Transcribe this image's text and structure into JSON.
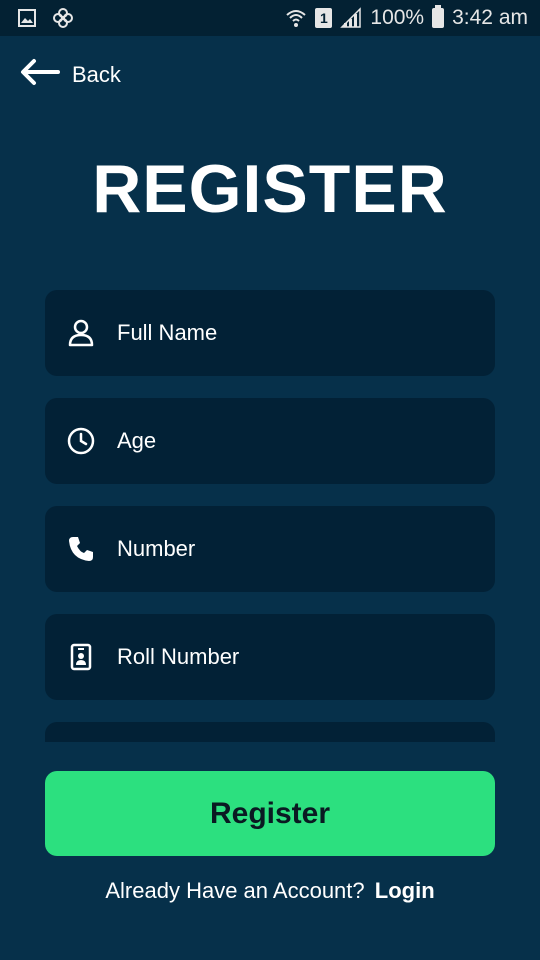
{
  "status_bar": {
    "battery_percent": "100%",
    "time": "3:42 am",
    "sim_slot": "1",
    "icons": [
      "gallery-icon",
      "pinwheel-icon",
      "wifi-icon",
      "sim-icon",
      "signal-icon",
      "battery-icon"
    ]
  },
  "header": {
    "back_label": "Back",
    "title": "REGISTER"
  },
  "form": {
    "fields": [
      {
        "placeholder": "Full Name",
        "icon": "person-icon",
        "value": ""
      },
      {
        "placeholder": "Age",
        "icon": "clock-icon",
        "value": ""
      },
      {
        "placeholder": "Number",
        "icon": "phone-icon",
        "value": ""
      },
      {
        "placeholder": "Roll Number",
        "icon": "id-card-icon",
        "value": ""
      }
    ]
  },
  "actions": {
    "register_label": "Register",
    "login_prompt": "Already Have an Account?",
    "login_label": "Login"
  },
  "colors": {
    "background": "#06304a",
    "field_background": "#022136",
    "accent": "#2ce07f",
    "status_bar": "#032133"
  }
}
